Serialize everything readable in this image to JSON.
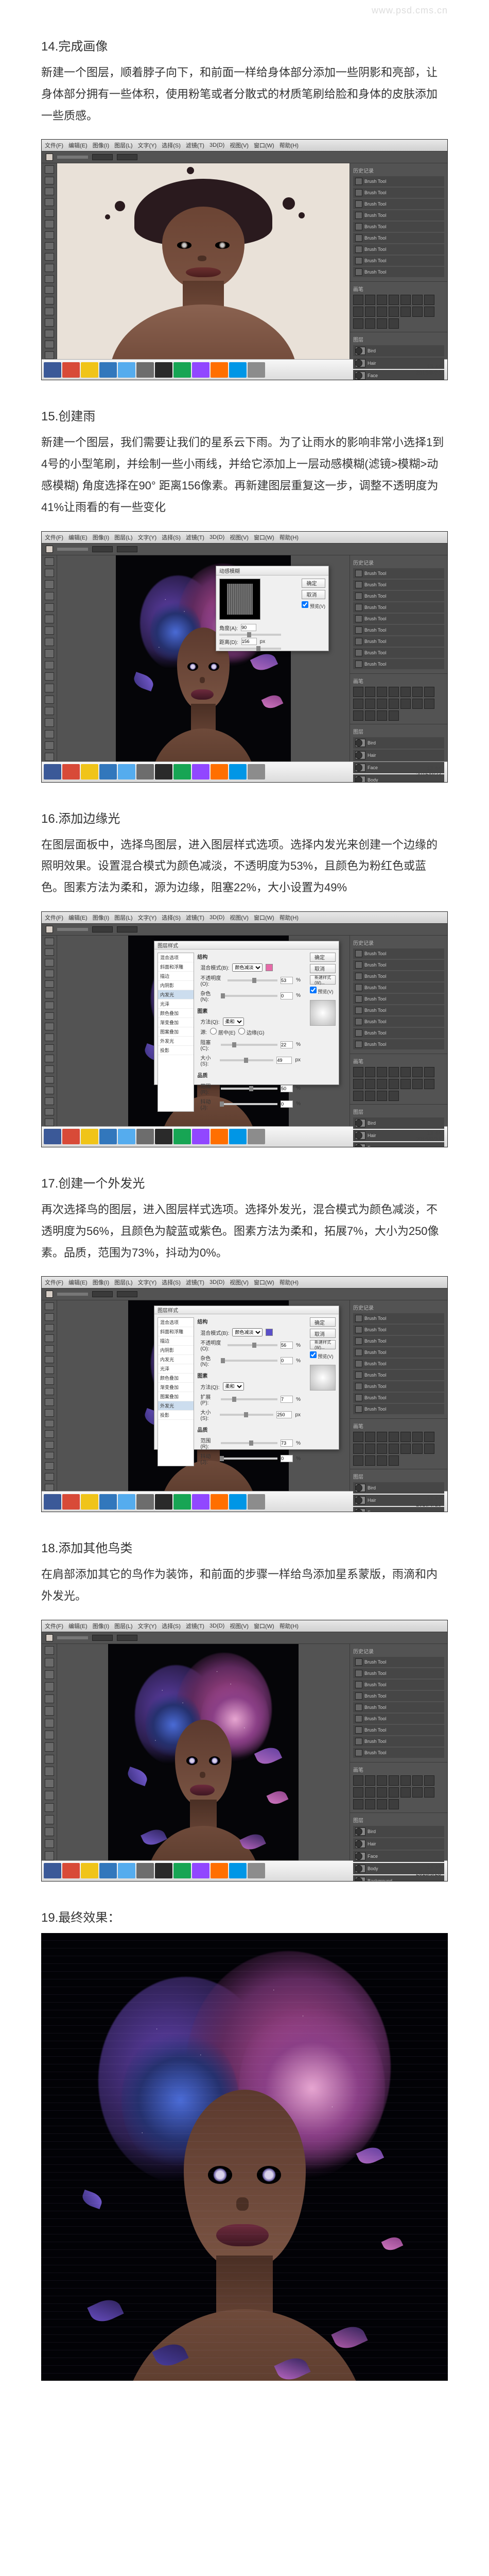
{
  "watermark": "www.psd.cms.cn",
  "menubar": [
    "文件(F)",
    "编辑(E)",
    "图像(I)",
    "图层(L)",
    "文字(Y)",
    "选择(S)",
    "滤镜(T)",
    "3D(D)",
    "视图(V)",
    "窗口(W)",
    "帮助(H)"
  ],
  "taskbar_icons": [
    "#3b5998",
    "#d84a38",
    "#f0c419",
    "#3277bc",
    "#55acee",
    "#6d6d6d",
    "#2a2a2a",
    "#17a554",
    "#9147ff",
    "#ff6f00",
    "#0096e6",
    "#8c8c8c"
  ],
  "clock": {
    "time": "13:44",
    "date": "2015/9/23"
  },
  "panels": {
    "history": "历史记录",
    "history_items": [
      "Brush Tool",
      "Brush Tool",
      "Brush Tool",
      "Brush Tool",
      "Brush Tool",
      "Brush Tool",
      "Brush Tool",
      "Brush Tool",
      "Brush Tool"
    ],
    "layers": "图层",
    "layer_items": [
      "Bird",
      "Hair",
      "Face",
      "Body",
      "Background"
    ],
    "preset": "画笔"
  },
  "dialog": {
    "layer_style_title": "图层样式",
    "motion_blur_title": "动感模糊",
    "items": [
      "混合选项",
      "斜面和浮雕",
      "描边",
      "内阴影",
      "内发光",
      "光泽",
      "颜色叠加",
      "渐变叠加",
      "图案叠加",
      "外发光",
      "投影"
    ],
    "ok": "确定",
    "cancel": "取消",
    "new_style": "新建样式(W)...",
    "preview": "预览(V)",
    "fields": {
      "structure": "结构",
      "blend_mode": "混合模式(B):",
      "color_dodge": "颜色减淡",
      "opacity": "不透明度(O):",
      "noise": "杂色(N):",
      "elements": "图素",
      "technique": "方法(Q):",
      "softer": "柔和",
      "source": "源:",
      "center": "居中(E)",
      "edge": "边缘(G)",
      "choke": "阻塞(C):",
      "spread": "扩展(P):",
      "size": "大小(S):",
      "quality": "品质",
      "range": "范围(R):",
      "jitter": "抖动(J):",
      "angle": "角度(A):",
      "distance": "距离(D):"
    }
  },
  "steps": [
    {
      "num": "14",
      "title": "完成画像",
      "desc": "新建一个图层，顺着脖子向下，和前面一样给身体部分添加一些阴影和亮部，让身体部分拥有一些体积，使用粉笔或者分散式的材质笔刷给脸和身体的皮肤添加一些质感。",
      "type": "ps_step14"
    },
    {
      "num": "15",
      "title": "创建雨",
      "desc": "新建一个图层，我们需要让我们的星系云下雨。为了让雨水的影响非常小选择1到4号的小型笔刷，并绘制一些小雨线，并给它添加上一层动感模糊(滤镜>模糊>动感模糊) 角度选择在90° 距离156像素。再新建图层重复这一步，调整不透明度为41%让雨看的有一些变化",
      "type": "ps_step15"
    },
    {
      "num": "16",
      "title": "添加边缘光",
      "desc": "在图层面板中，选择鸟图层，进入图层样式选项。选择内发光来创建一个边缘的照明效果。设置混合模式为颜色减淡，不透明度为53%，且颜色为粉红色或蓝色。图素方法为柔和，源为边缘，阻塞22%，大小设置为49%",
      "type": "ps_step16",
      "values": {
        "opacity": "53",
        "choke": "22",
        "size": "49"
      }
    },
    {
      "num": "17",
      "title": "创建一个外发光",
      "desc": "再次选择鸟的图层，进入图层样式选项。选择外发光，混合模式为颜色减淡，不透明度为56%，且颜色为靛蓝或紫色。图素方法为柔和，拓展7%，大小为250像素。品质，范围为73%，抖动为0%。",
      "type": "ps_step17",
      "values": {
        "opacity": "56",
        "spread": "7",
        "size": "250",
        "range": "73",
        "jitter": "0"
      }
    },
    {
      "num": "18",
      "title": "添加其他鸟类",
      "desc": "在肩部添加其它的鸟作为装饰，和前面的步骤一样给鸟添加星系蒙版，雨滴和内外发光。",
      "type": "ps_step18"
    },
    {
      "num": "19",
      "title": "最终效果：",
      "desc": "",
      "type": "final"
    }
  ]
}
